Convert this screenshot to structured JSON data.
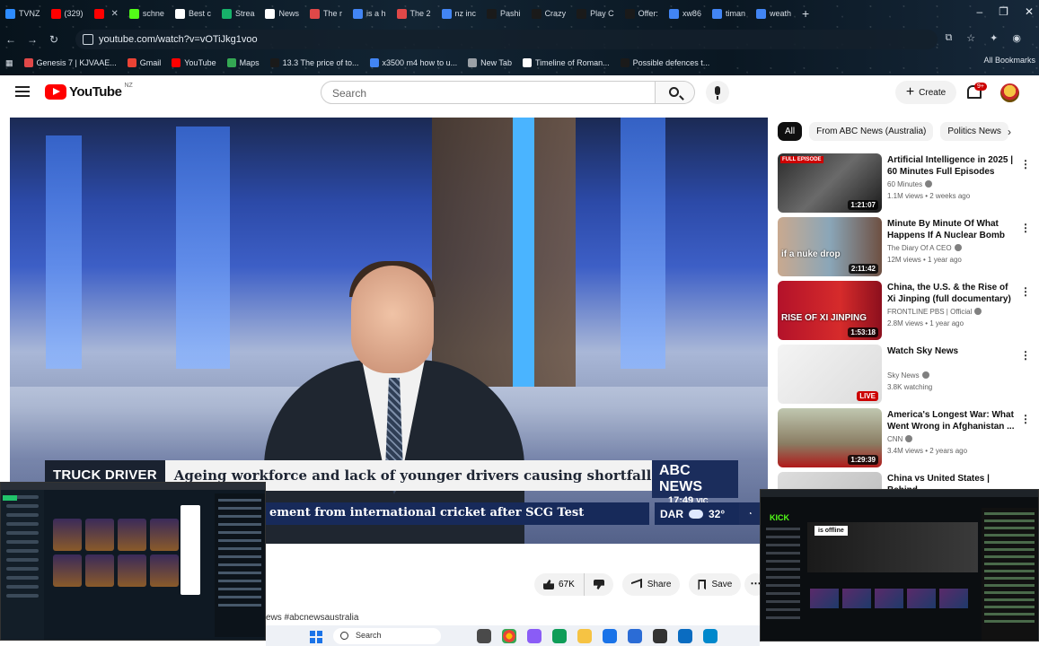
{
  "browser": {
    "tabs": [
      {
        "label": "TVNZ",
        "color": "#2d8cff"
      },
      {
        "label": "(329)",
        "color": "#ff0000"
      },
      {
        "label": "",
        "color": "#ff0000"
      },
      {
        "label": "schne",
        "color": "#53fc18"
      },
      {
        "label": "Best c",
        "color": "#ffffff"
      },
      {
        "label": "Strea",
        "color": "#17b26a"
      },
      {
        "label": "News",
        "color": "#ffffff"
      },
      {
        "label": "The r",
        "color": "#e04848"
      },
      {
        "label": "is a h",
        "color": "#4285f4"
      },
      {
        "label": "The 2",
        "color": "#e04848"
      },
      {
        "label": "nz inc",
        "color": "#4285f4"
      },
      {
        "label": "Pashi",
        "color": "#1a1a1a"
      },
      {
        "label": "Crazy",
        "color": "#1a1a1a"
      },
      {
        "label": "Play C",
        "color": "#1a1a1a"
      },
      {
        "label": "Offer:",
        "color": "#1a1a1a"
      },
      {
        "label": "xw86",
        "color": "#4285f4"
      },
      {
        "label": "timan",
        "color": "#4285f4"
      },
      {
        "label": "weath",
        "color": "#4285f4"
      }
    ],
    "url": "youtube.com/watch?v=vOTiJkg1voo",
    "bookmarks": [
      {
        "label": "Genesis 7 | KJVAAE...",
        "color": "#e04848"
      },
      {
        "label": "Gmail",
        "color": "#ea4335"
      },
      {
        "label": "YouTube",
        "color": "#ff0000"
      },
      {
        "label": "Maps",
        "color": "#34a853"
      },
      {
        "label": "13.3 The price of to...",
        "color": "#1a1a1a"
      },
      {
        "label": "x3500 m4 how to u...",
        "color": "#4285f4"
      },
      {
        "label": "New Tab",
        "color": "#9aa0a6"
      },
      {
        "label": "Timeline of Roman...",
        "color": "#ffffff"
      },
      {
        "label": "Possible defences t...",
        "color": "#1a1a1a"
      }
    ],
    "all_bookmarks": "All Bookmarks"
  },
  "youtube": {
    "logo": "YouTube",
    "country": "NZ",
    "search_placeholder": "Search",
    "create_label": "Create",
    "notif_badge": "9+"
  },
  "video": {
    "lower_third_label": "TRUCK DRIVER",
    "headline": "Ageing workforce and lack of younger drivers causing shortfall",
    "brand": "ABC NEWS",
    "time": "17:49",
    "time_zone": "VIC",
    "ticker": "ement from international cricket after SCG Test",
    "weather_city": "DAR",
    "weather_temp": "32°"
  },
  "chips": [
    "All",
    "From ABC News (Australia)",
    "Politics News"
  ],
  "recommendations": [
    {
      "title": "Artificial Intelligence in 2025 | 60 Minutes Full Episodes",
      "channel": "60 Minutes",
      "meta": "1.1M views • 2 weeks ago",
      "duration": "1:21:07",
      "tag": "FULL EPISODE",
      "thumb": "linear-gradient(135deg,#2b2b2b,#6a6a6a 50%,#1a1a1a)",
      "caption": ""
    },
    {
      "title": "Minute By Minute Of What Happens If A Nuclear Bomb ...",
      "channel": "The Diary Of A CEO",
      "meta": "12M views • 1 year ago",
      "duration": "2:11:42",
      "tag": "",
      "thumb": "linear-gradient(90deg,#c9a98f,#8aa6b8 50%,#6e5042)",
      "caption": "if a nuke drop"
    },
    {
      "title": "China, the U.S. & the Rise of Xi Jinping (full documentary) | ...",
      "channel": "FRONTLINE PBS | Official",
      "meta": "2.8M views • 1 year ago",
      "duration": "1:53:18",
      "tag": "",
      "thumb": "linear-gradient(90deg,#b3122a,#d62b2b 60%,#8c0f1d)",
      "caption": "RISE OF XI JINPING"
    },
    {
      "title": "Watch Sky News",
      "channel": "Sky News",
      "meta": "3.8K watching",
      "duration": "LIVE",
      "tag": "",
      "thumb": "linear-gradient(135deg,#f4f4f4,#dcdcdc)",
      "caption": ""
    },
    {
      "title": "America's Longest War: What Went Wrong in Afghanistan ...",
      "channel": "CNN",
      "meta": "3.4M views • 2 years ago",
      "duration": "1:29:39",
      "tag": "",
      "thumb": "linear-gradient(180deg,#c0c7b0,#8a7d63 60%,#b01a1a)",
      "caption": ""
    },
    {
      "title": "China vs United States | Behind",
      "channel": "",
      "meta": "",
      "duration": "",
      "tag": "",
      "thumb": "linear-gradient(135deg,#ddd,#bbb)",
      "caption": ""
    }
  ],
  "actions": {
    "likes": "67K",
    "share": "Share",
    "save": "Save"
  },
  "description_hashtag": "ews #abcnewsaustralia",
  "taskbar": {
    "search": "Search"
  },
  "pip_right": {
    "logo": "KICK",
    "offline": "is offline"
  }
}
